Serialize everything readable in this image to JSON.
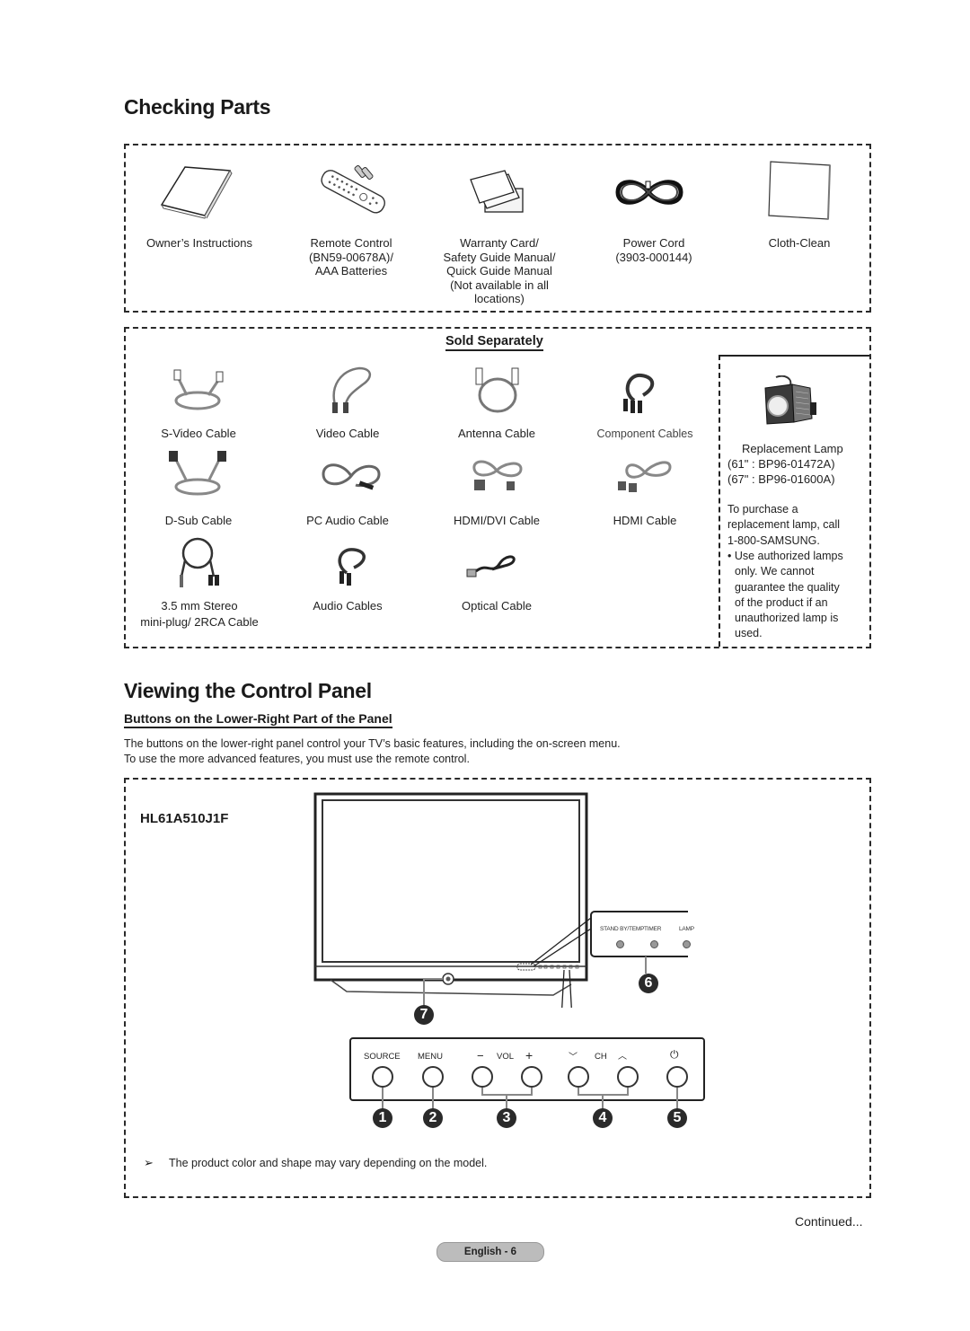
{
  "sections": {
    "checking_parts": {
      "title": "Checking Parts"
    },
    "sold_separately": {
      "title": "Sold Separately"
    },
    "control_panel": {
      "title": "Viewing the Control Panel",
      "subtitle": "Buttons on the Lower-Right Part of the Panel",
      "description_line1": "The buttons on the lower-right panel control your TV’s basic features, including the on-screen menu.",
      "description_line2": "To use the more advanced features, you must use the remote control.",
      "model": "HL61A510J1F",
      "note": "The product color and shape may vary depending on the model."
    }
  },
  "included_parts": [
    {
      "icon": "manual-icon",
      "lines": [
        "Owner’s Instructions"
      ]
    },
    {
      "icon": "remote-control-icon",
      "lines": [
        "Remote Control",
        "(BN59-00678A)/",
        "AAA Batteries"
      ]
    },
    {
      "icon": "cards-icon",
      "lines": [
        "Warranty Card/",
        "Safety Guide Manual/",
        "Quick Guide Manual",
        "(Not available in all",
        "locations)"
      ]
    },
    {
      "icon": "power-cord-icon",
      "lines": [
        "Power Cord",
        "(3903-000144)"
      ]
    },
    {
      "icon": "cloth-icon",
      "lines": [
        "Cloth-Clean"
      ]
    }
  ],
  "sold_items": [
    {
      "icon": "s-video-cable-icon",
      "lines": [
        "S-Video Cable"
      ]
    },
    {
      "icon": "video-cable-icon",
      "lines": [
        "Video Cable"
      ]
    },
    {
      "icon": "antenna-cable-icon",
      "lines": [
        "Antenna Cable"
      ]
    },
    {
      "icon": "component-cables-icon",
      "lines": [
        "Component Cables"
      ]
    },
    {
      "icon": "d-sub-cable-icon",
      "lines": [
        "D-Sub Cable"
      ]
    },
    {
      "icon": "pc-audio-cable-icon",
      "lines": [
        "PC Audio Cable"
      ]
    },
    {
      "icon": "hdmi-dvi-cable-icon",
      "lines": [
        "HDMI/DVI Cable"
      ]
    },
    {
      "icon": "hdmi-cable-icon",
      "lines": [
        "HDMI Cable"
      ]
    },
    {
      "icon": "stereo-mini-plug-cable-icon",
      "lines": [
        "3.5 mm Stereo",
        "mini-plug/ 2RCA Cable"
      ]
    },
    {
      "icon": "audio-cables-icon",
      "lines": [
        "Audio Cables"
      ]
    },
    {
      "icon": "optical-cable-icon",
      "lines": [
        "Optical Cable"
      ]
    }
  ],
  "replacement_lamp": {
    "title": "Replacement Lamp",
    "part_61": "(61\" : BP96-01472A)",
    "part_67": "(67\" : BP96-01600A)",
    "purchase_line1": "To purchase a",
    "purchase_line2": "replacement lamp, call",
    "purchase_line3": "1-800-SAMSUNG.",
    "warning_lines": [
      "• Use authorized lamps",
      "only. We cannot",
      "guarantee the quality",
      "of the product if an",
      "unauthorized lamp is",
      "used."
    ]
  },
  "indicator_panel": {
    "labels": [
      "STAND BY/TEMP",
      "TIMER",
      "LAMP"
    ],
    "callout": "6"
  },
  "button_panel": {
    "labels": {
      "source": "SOURCE",
      "menu": "MENU",
      "vol_minus": "−",
      "vol": "VOL",
      "vol_plus": "+",
      "ch_down": "﹀",
      "ch": "CH",
      "ch_up": "︿",
      "power": "⏻"
    },
    "callouts": [
      "1",
      "2",
      "3",
      "4",
      "5"
    ],
    "sensor_callout": "7"
  },
  "footer": {
    "continued": "Continued...",
    "page_label": "English - 6"
  }
}
